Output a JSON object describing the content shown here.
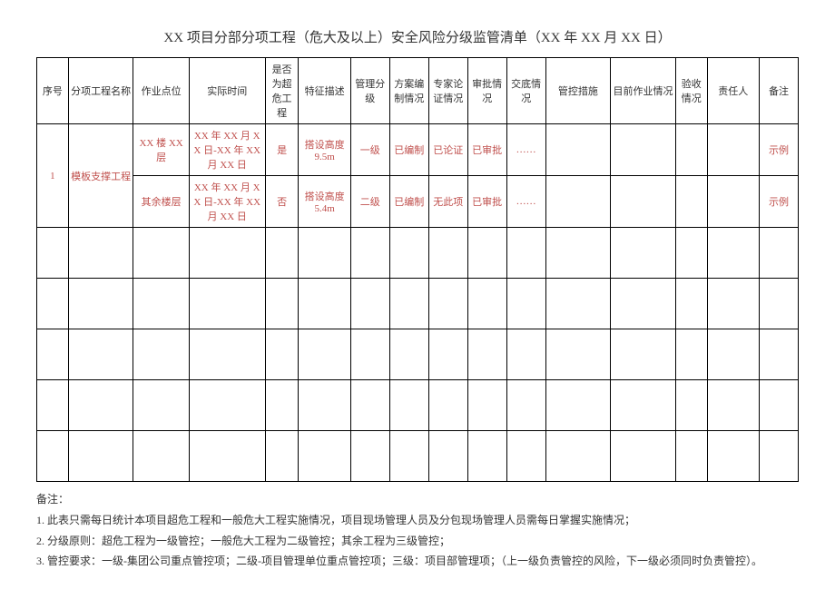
{
  "title": "XX 项目分部分项工程（危大及以上）安全风险分级监管清单（XX 年 XX 月 XX 日）",
  "headers": {
    "seq": "序号",
    "name": "分项工程名称",
    "loc": "作业点位",
    "time": "实际时间",
    "super": "是否为超危工程",
    "feat": "特征描述",
    "level": "管理分级",
    "plan": "方案编制情况",
    "expert": "专家论证情况",
    "approve": "审批情况",
    "disclose": "交底情况",
    "control": "管控措施",
    "current": "目前作业情况",
    "accept": "验收情况",
    "resp": "责任人",
    "remark": "备注"
  },
  "rows": [
    {
      "seq": "1",
      "name": "模板支撑工程",
      "loc": "XX 楼 XX 层",
      "time": "XX 年 XX 月 XX 日-XX 年 XX 月 XX 日",
      "super": "是",
      "feat": "搭设高度 9.5m",
      "level": "一级",
      "plan": "已编制",
      "expert": "已论证",
      "approve": "已审批",
      "disclose": "……",
      "control": "",
      "current": "",
      "accept": "",
      "resp": "",
      "remark": "示例"
    },
    {
      "loc": "其余楼层",
      "time": "XX 年 XX 月 XX 日-XX 年 XX 月 XX 日",
      "super": "否",
      "feat": "搭设高度 5.4m",
      "level": "二级",
      "plan": "已编制",
      "expert": "无此项",
      "approve": "已审批",
      "disclose": "……",
      "control": "",
      "current": "",
      "accept": "",
      "resp": "",
      "remark": "示例"
    }
  ],
  "notes_label": "备注：",
  "notes": [
    "1. 此表只需每日统计本项目超危工程和一般危大工程实施情况，项目现场管理人员及分包现场管理人员需每日掌握实施情况；",
    "2. 分级原则：超危工程为一级管控；一般危大工程为二级管控；其余工程为三级管控；",
    "3. 管控要求：一级-集团公司重点管控项；二级-项目管理单位重点管控项；三级：项目部管理项；（上一级负责管控的风险，下一级必须同时负责管控）。"
  ]
}
